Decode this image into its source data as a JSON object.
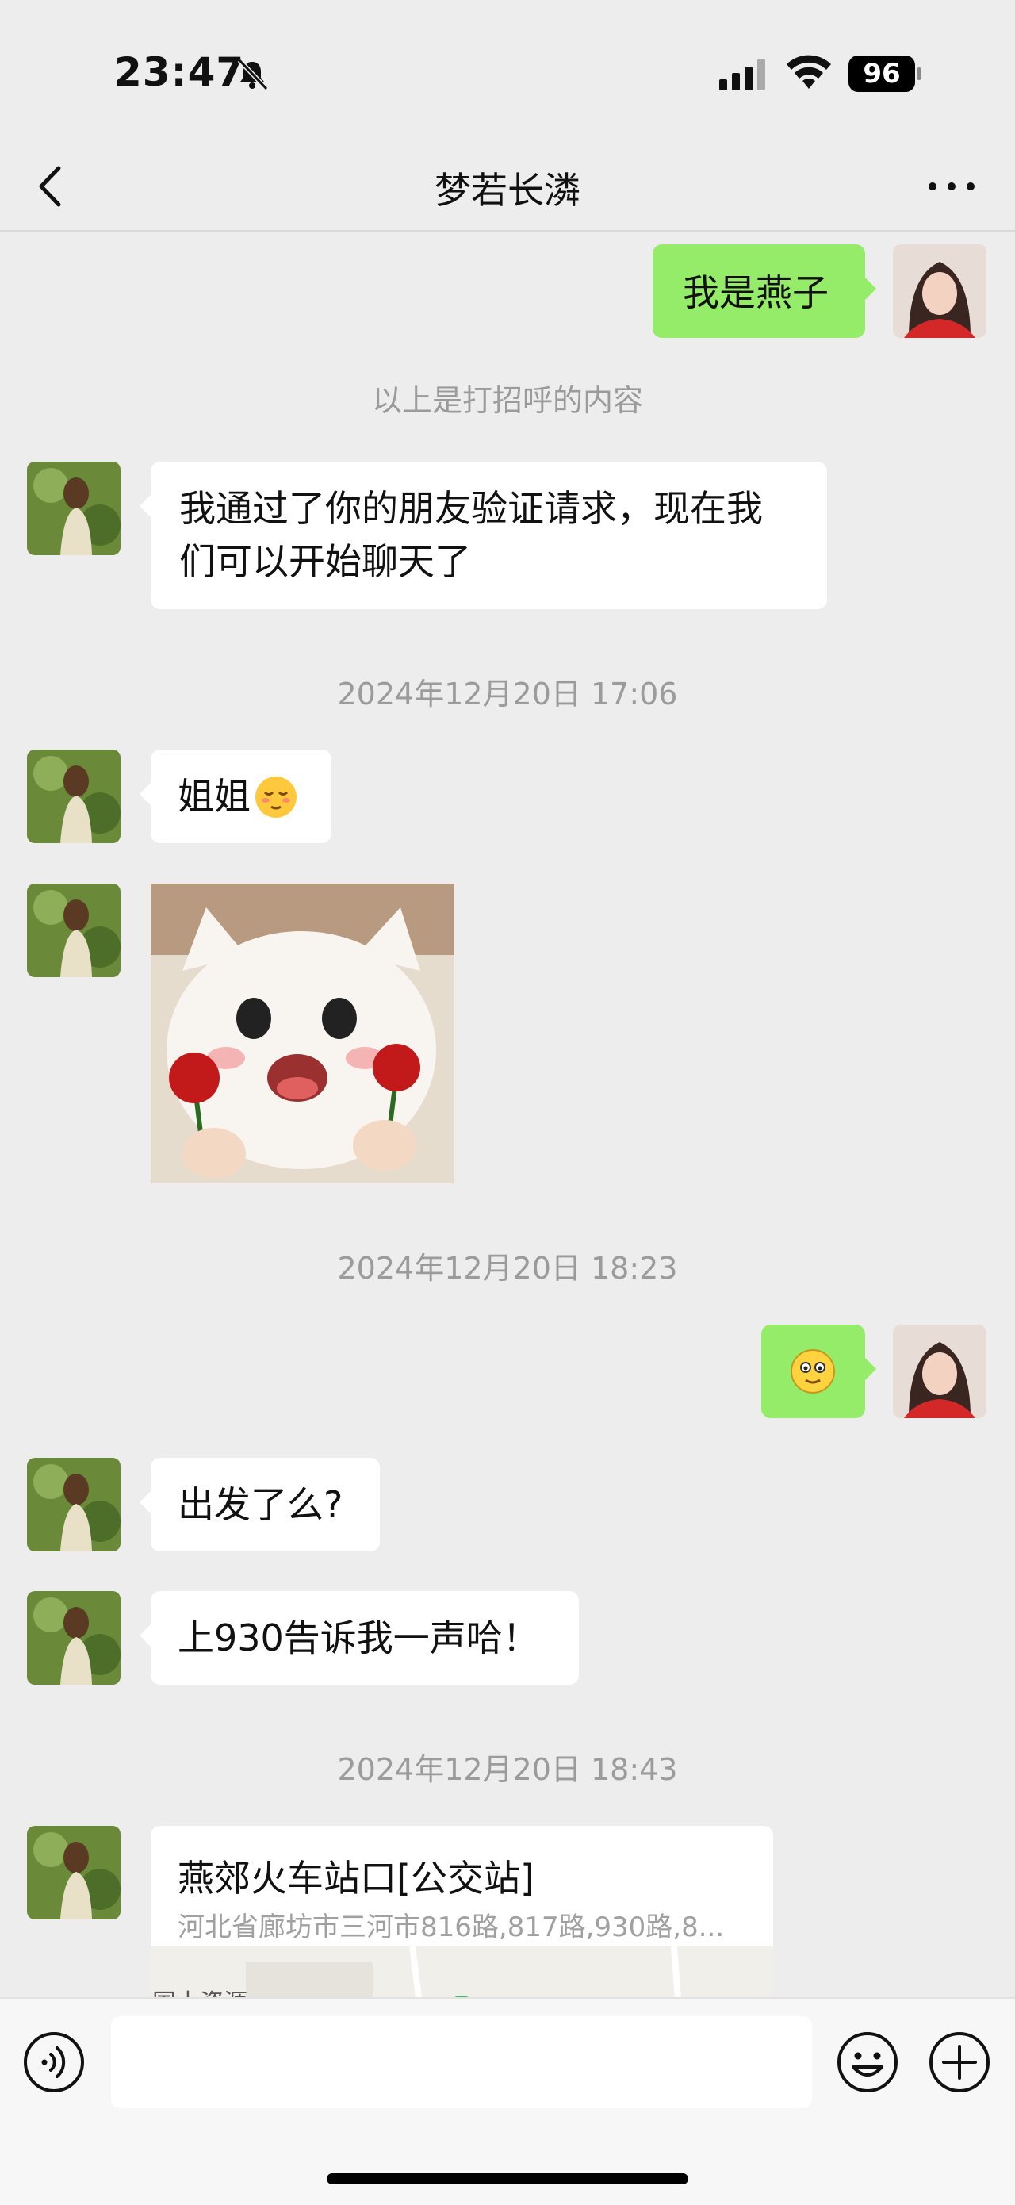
{
  "status_bar": {
    "time": "23:47",
    "battery": "96",
    "icons": [
      "bell-muted-icon",
      "signal-icon",
      "wifi-icon",
      "battery-icon"
    ]
  },
  "nav": {
    "title": "梦若长潾",
    "icons": [
      "chevron-left-icon",
      "more-dots-icon"
    ]
  },
  "messages": {
    "m1": {
      "text": "我是燕子"
    },
    "greeting_note": "以上是打招呼的内容",
    "m2": {
      "line1": "我通过了你的朋友验证请求，现在我",
      "line2": "们可以开始聊天了"
    },
    "time1": "2024年12月20日 17:06",
    "m3": {
      "text": "姐姐"
    },
    "time2": "2024年12月20日 18:23",
    "m6": {
      "text": "出发了么?"
    },
    "m7": {
      "text": "上930告诉我一声哈！"
    },
    "time3": "2024年12月20日 18:43",
    "location": {
      "title": "燕郊火车站口[公交站]",
      "address": "河北省廊坊市三河市816路,817路,930路,8...",
      "map_label": "国土资源"
    }
  },
  "input_bar": {
    "icons": [
      "voice-icon",
      "emoji-icon",
      "plus-icon"
    ]
  },
  "colors": {
    "background": "#ededed",
    "sent_bubble": "#95ec69",
    "received_bubble": "#ffffff",
    "system_text": "#9b9b9b"
  }
}
